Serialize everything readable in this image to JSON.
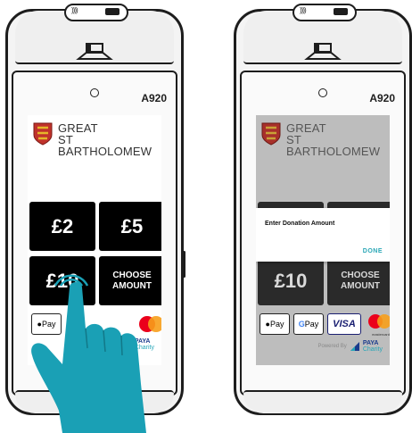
{
  "left_device": {
    "model": "A920",
    "organisation": [
      "GREAT",
      "ST BARTHOLOMEW"
    ],
    "tiles": {
      "two": "£2",
      "five": "£5",
      "ten": "£10",
      "choose": [
        "CHOOSE",
        "AMOUNT"
      ]
    },
    "payments": {
      "apple_pay": "Pay",
      "paya_line1": "PAYA",
      "paya_line2": "Charity"
    }
  },
  "right_device": {
    "model": "A920",
    "organisation": [
      "GREAT",
      "ST BARTHOLOMEW"
    ],
    "dialog": {
      "title": "Enter Donation Amount",
      "done": "DONE"
    },
    "tiles": {
      "ten": "£10",
      "choose": [
        "CHOOSE",
        "AMOUNT"
      ]
    },
    "payments": {
      "apple_pay": "Pay",
      "google_pay": "Pay",
      "visa": "VISA",
      "mastercard": "mastercard",
      "powered_by": "Powered By",
      "paya_line1": "PAYA",
      "paya_line2": "Charity"
    }
  },
  "colors": {
    "device": "#1d1d1d",
    "tile": "#000000",
    "dim_screen": "#bdbdbd",
    "accent": "#2aa7b6",
    "hand": "#1aa0b5"
  }
}
